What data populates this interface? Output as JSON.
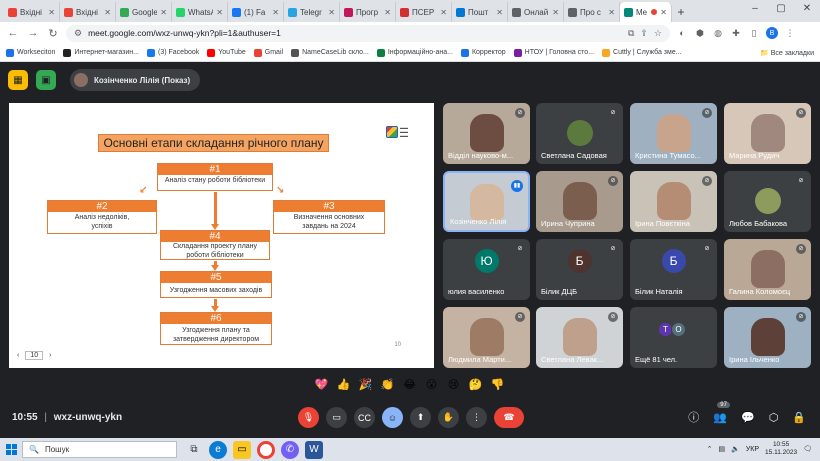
{
  "browser": {
    "tabs": [
      {
        "label": "Вхідні",
        "color": "#ea4335"
      },
      {
        "label": "Вхідні",
        "color": "#ea4335"
      },
      {
        "label": "Google",
        "color": "#34a853"
      },
      {
        "label": "WhatsApp",
        "color": "#25d366"
      },
      {
        "label": "(1) Fa",
        "color": "#1877f2"
      },
      {
        "label": "Telegr",
        "color": "#2aa3e2"
      },
      {
        "label": "Прогр",
        "color": "#c2185b"
      },
      {
        "label": "ПСЕР",
        "color": "#d32f2f"
      },
      {
        "label": "Пошт",
        "color": "#0078d4"
      },
      {
        "label": "Онлай",
        "color": "#5f6368"
      },
      {
        "label": "Про с",
        "color": "#5f6368"
      },
      {
        "label": "Me",
        "color": "#00897b"
      }
    ],
    "url": "meet.google.com/wxz-unwq-ykn?pli=1&authuser=1",
    "profile_initial": "B",
    "bookmarks": [
      {
        "label": "Workseciton",
        "color": "#1a73e8"
      },
      {
        "label": "Интернет-магазин...",
        "color": "#222222"
      },
      {
        "label": "(3) Facebook",
        "color": "#1877f2"
      },
      {
        "label": "YouTube",
        "color": "#ff0000"
      },
      {
        "label": "Gmail",
        "color": "#ea4335"
      },
      {
        "label": "NameCaseLib склo...",
        "color": "#555555"
      },
      {
        "label": "Інформаційно-ана...",
        "color": "#0b8043"
      },
      {
        "label": "Корректор",
        "color": "#1a73e8"
      },
      {
        "label": "НТОУ | Головна сто...",
        "color": "#7b1fa2"
      },
      {
        "label": "Cuttly | Служба зме...",
        "color": "#f9a825"
      }
    ],
    "all_bookmarks": "Все закладки"
  },
  "meet": {
    "presenter": "Козінченко Лілія (Показ)",
    "meeting_time": "10:55",
    "meeting_code": "wxz-unwq-ykn",
    "participants_count": "97",
    "reactions": [
      "💖",
      "👍",
      "🎉",
      "👏",
      "😂",
      "😮",
      "😢",
      "🤔",
      "👎"
    ],
    "participants": [
      {
        "name": "Відділ науково-м...",
        "type": "video",
        "bg": "#b6a99a",
        "skin": "#6d4c41"
      },
      {
        "name": "Светлана Садовая",
        "type": "avatar",
        "bg": "#3c4043",
        "skin": "#5d7a3e"
      },
      {
        "name": "Кристина Тумасо...",
        "type": "video",
        "bg": "#9fb0c0",
        "skin": "#c8a48c"
      },
      {
        "name": "Марина Рудич",
        "type": "video",
        "bg": "#d7c7b8",
        "skin": "#a1887f"
      },
      {
        "name": "Козінченко Лілія",
        "type": "video",
        "bg": "#c5cbd3",
        "skin": "#d4b8a0",
        "active": true
      },
      {
        "name": "Ирина Чуприна",
        "type": "video",
        "bg": "#a89a8c",
        "skin": "#7b5e4e"
      },
      {
        "name": "Ірина Повєткіна",
        "type": "video",
        "bg": "#c9c2b6",
        "skin": "#b58d74"
      },
      {
        "name": "Любов Бабакова",
        "type": "avatar",
        "bg": "#3c4043",
        "skin": "#8d9b5c"
      },
      {
        "name": "юлия василенко",
        "type": "letter",
        "letter": "Ю",
        "color": "#00796b"
      },
      {
        "name": "Білик ДЦБ",
        "type": "letter",
        "letter": "Б",
        "color": "#4e342e"
      },
      {
        "name": "Білик Наталія",
        "type": "letter",
        "letter": "Б",
        "color": "#3949ab"
      },
      {
        "name": "Галина Коломоєц",
        "type": "video",
        "bg": "#b9a896",
        "skin": "#8d6e63"
      },
      {
        "name": "Людмила Марти...",
        "type": "video",
        "bg": "#c4b2a3",
        "skin": "#9e7b65"
      },
      {
        "name": "Светлана Левак...",
        "type": "video",
        "bg": "#cfd3d6",
        "skin": "#bfa08c"
      },
      {
        "name": "Ещё 81 чел.",
        "type": "more",
        "letters": [
          "Т",
          "О"
        ],
        "colors": [
          "#5e35b1",
          "#546e7a"
        ]
      },
      {
        "name": "Ірина Ільченко",
        "type": "video",
        "bg": "#9db1c2",
        "skin": "#5d4037"
      }
    ]
  },
  "slide": {
    "title": "Основні етапи складання річного плану",
    "page": "10",
    "slide_number": "10",
    "boxes": {
      "b1": {
        "num": "#1",
        "text": "Аналіз стану роботи бібліотеки"
      },
      "b2": {
        "num": "#2",
        "text": "Аналіз недоліків, успіхів"
      },
      "b3": {
        "num": "#3",
        "text": "Визначення основних завдань на 2024"
      },
      "b4": {
        "num": "#4",
        "text": "Складання проекту плану роботи бібліотеки"
      },
      "b5": {
        "num": "#5",
        "text": "Узгодження масових заходів"
      },
      "b6": {
        "num": "#6",
        "text": "Узгодження плану та затвердження директором"
      }
    }
  },
  "taskbar": {
    "search_placeholder": "Пошук",
    "lang": "УКР",
    "time": "10:55",
    "date": "15.11.2023"
  }
}
